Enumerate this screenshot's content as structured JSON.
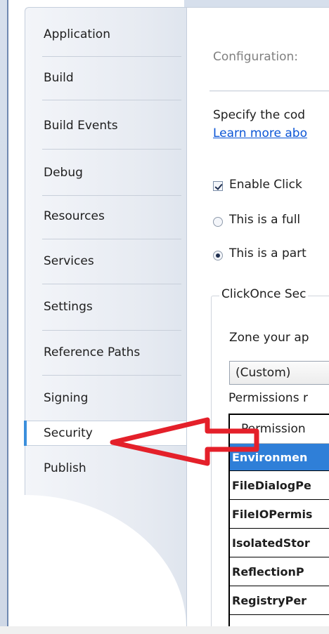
{
  "sidebar": {
    "items": [
      {
        "label": "Application"
      },
      {
        "label": "Build"
      },
      {
        "label": "Build Events"
      },
      {
        "label": "Debug"
      },
      {
        "label": "Resources"
      },
      {
        "label": "Services"
      },
      {
        "label": "Settings"
      },
      {
        "label": "Reference Paths"
      },
      {
        "label": "Signing"
      },
      {
        "label": "Security",
        "selected": true
      },
      {
        "label": "Publish"
      }
    ]
  },
  "main": {
    "configuration_label": "Configuration:",
    "specify_text": "Specify the cod",
    "learn_more_link": "Learn more abo",
    "enable_clickonce_label": "Enable Click",
    "enable_clickonce_checked": true,
    "full_trust_label": "This is a full",
    "partial_trust_label": "This is a part",
    "selected_trust": "partial",
    "group_title": "ClickOnce Sec",
    "zone_label": "Zone your ap",
    "zone_value": "(Custom)",
    "permissions_label": "Permissions r",
    "permissions_table": {
      "header": "Permission",
      "rows": [
        {
          "name": "Environmen",
          "selected": true
        },
        {
          "name": "FileDialogPe"
        },
        {
          "name": "FileIOPermis"
        },
        {
          "name": "IsolatedStor"
        },
        {
          "name": "ReflectionP"
        },
        {
          "name": "RegistryPer"
        }
      ]
    }
  },
  "annotation": {
    "color": "#e4202a"
  },
  "colors": {
    "accent": "#3b8fdc",
    "selection": "#2f7fd8",
    "link": "#0b55d6"
  }
}
